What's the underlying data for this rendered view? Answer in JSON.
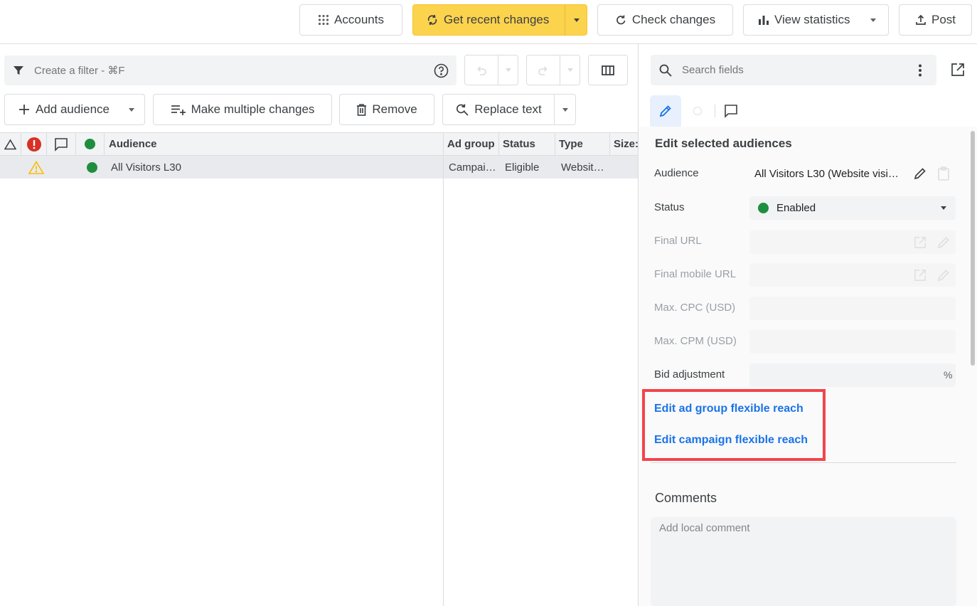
{
  "toolbar": {
    "accounts": "Accounts",
    "get_recent_changes": "Get recent changes",
    "check_changes": "Check changes",
    "view_statistics": "View statistics",
    "post": "Post"
  },
  "filter": {
    "placeholder": "Create a filter - ⌘F"
  },
  "actions": {
    "add_audience": "Add audience",
    "make_multiple_changes": "Make multiple changes",
    "remove": "Remove",
    "replace_text": "Replace text"
  },
  "grid": {
    "columns": [
      "Audience",
      "Ad group",
      "Status",
      "Type",
      "Size:"
    ],
    "rows": [
      {
        "audience": "All Visitors L30",
        "ad_group": "Campai…",
        "status": "Eligible",
        "type": "Websit…"
      }
    ]
  },
  "side_panel": {
    "search_placeholder": "Search fields",
    "section_title": "Edit selected audiences",
    "fields": {
      "audience_label": "Audience",
      "audience_value": "All Visitors L30 (Website visi…",
      "status_label": "Status",
      "status_value": "Enabled",
      "final_url_label": "Final URL",
      "final_mobile_url_label": "Final mobile URL",
      "max_cpc_label": "Max. CPC (USD)",
      "max_cpm_label": "Max. CPM (USD)",
      "bid_adjustment_label": "Bid adjustment",
      "bid_adjustment_unit": "%"
    },
    "links": {
      "edit_ad_group_flexible_reach": "Edit ad group flexible reach",
      "edit_campaign_flexible_reach": "Edit campaign flexible reach"
    },
    "comments_title": "Comments",
    "comment_placeholder": "Add local comment"
  },
  "colors": {
    "accent_blue": "#1a73e8",
    "primary_yellow": "#fcd34d",
    "enabled_green": "#1e8e3e",
    "error_red": "#d93025",
    "warning_yellow": "#fbbc04",
    "highlight_red": "#f2444b"
  },
  "icons": [
    "apps-grid-icon",
    "sync-icon",
    "refresh-icon",
    "bar-chart-icon",
    "upload-icon",
    "filter-icon",
    "help-icon",
    "undo-icon",
    "redo-icon",
    "columns-icon",
    "plus-icon",
    "playlist-add-icon",
    "trash-icon",
    "find-replace-icon",
    "search-icon",
    "more-vert-icon",
    "open-in-new-icon",
    "pencil-icon",
    "comment-icon",
    "warning-icon",
    "error-icon",
    "status-dot-icon",
    "copy-icon"
  ]
}
